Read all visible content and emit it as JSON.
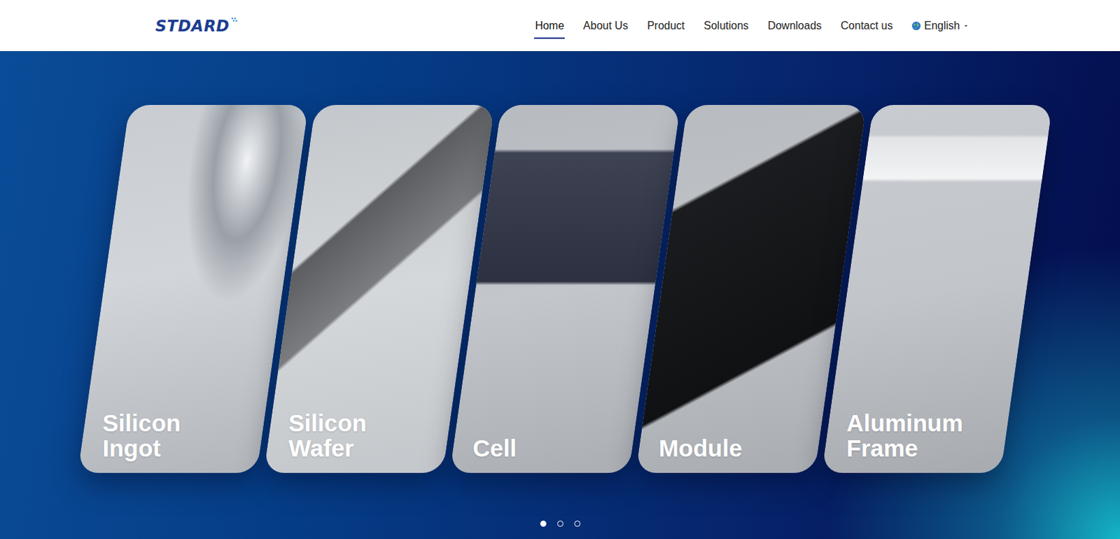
{
  "logo": "STDARD",
  "nav": [
    {
      "label": "Home",
      "selected": true
    },
    {
      "label": "About Us",
      "selected": false
    },
    {
      "label": "Product",
      "selected": false
    },
    {
      "label": "Solutions",
      "selected": false
    },
    {
      "label": "Downloads",
      "selected": false
    },
    {
      "label": "Contact us",
      "selected": false
    }
  ],
  "language": {
    "label": "English"
  },
  "cards": [
    {
      "title": "Silicon Ingot"
    },
    {
      "title": "Silicon Wafer"
    },
    {
      "title": "Cell"
    },
    {
      "title": "Module"
    },
    {
      "title": "Aluminum Frame"
    }
  ],
  "carousel": {
    "dots": [
      {
        "selected": true
      },
      {
        "selected": false
      },
      {
        "selected": false
      }
    ]
  }
}
